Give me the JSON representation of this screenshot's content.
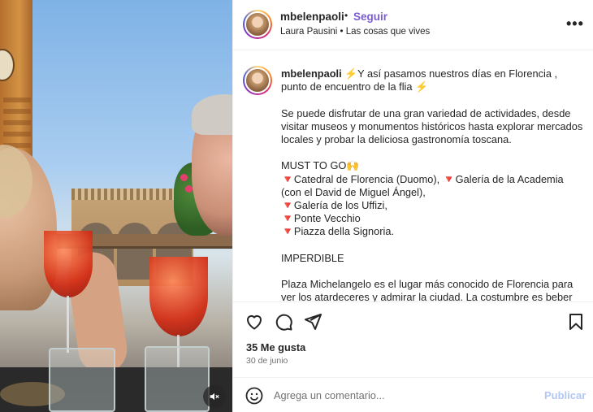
{
  "post": {
    "username": "mbelenpaoli",
    "follow_label": "Seguir",
    "separator": "•",
    "music": "Laura Pausini • Las cosas que vives",
    "caption": {
      "intro": "⚡️Y así pasamos nuestros días en Florencia , punto de encuentro de la flia ⚡️",
      "paragraph": "Se puede disfrutar de una gran variedad de actividades, desde visitar museos y monumentos históricos hasta explorar mercados locales y probar la deliciosa gastronomía toscana.",
      "must_heading": "MUST TO GO🙌",
      "must_list": "🔻Catedral de Florencia (Duomo),  🔻Galería de la Academia (con el David de Miguel Ángel),\n🔻Galería de los Uffizi,\n🔻Ponte Vecchio\n🔻Piazza della Signoria.",
      "imperdible": "IMPERDIBLE",
      "closing": "Plaza Michelangelo es el lugar más conocido de Florencia para ver los atardeceres y admirar la ciudad. La costumbre es beber"
    },
    "likes": "35 Me gusta",
    "date": "30 de junio"
  },
  "comment": {
    "placeholder": "Agrega un comentario...",
    "post_label": "Publicar"
  },
  "colors": {
    "follow": "#7b5cd6",
    "post_disabled": "#b3c7f5",
    "muted_text": "#737373"
  }
}
